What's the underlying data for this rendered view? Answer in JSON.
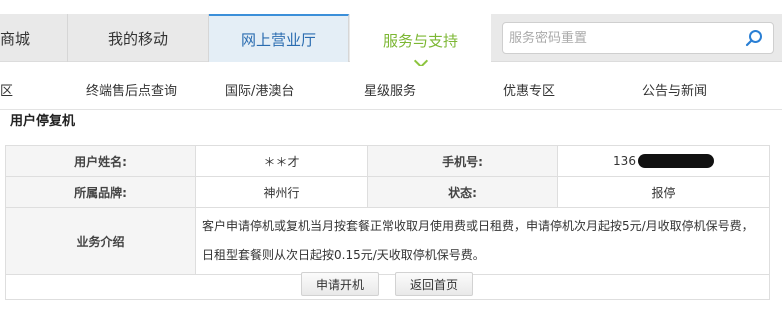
{
  "topnav": {
    "tabs": [
      {
        "label": "商城"
      },
      {
        "label": "我的移动"
      },
      {
        "label": "网上营业厅"
      },
      {
        "label": "服务与支持"
      }
    ],
    "search_placeholder": "服务密码重置",
    "search_icon": "search-icon"
  },
  "subnav": {
    "items": [
      {
        "label": "区"
      },
      {
        "label": "终端售后点查询"
      },
      {
        "label": "国际/港澳台"
      },
      {
        "label": "星级服务"
      },
      {
        "label": "优惠专区"
      },
      {
        "label": "公告与新闻"
      }
    ]
  },
  "section_title": "用户停复机",
  "info": {
    "name_label": "用户姓名:",
    "name_value": "＊＊才",
    "phone_label": "手机号:",
    "phone_value": "136",
    "brand_label": "所属品牌:",
    "brand_value": "神州行",
    "status_label": "状态:",
    "status_value": "报停",
    "intro_label": "业务介绍",
    "intro_text": "客户申请停机或复机当月按套餐正常收取月使用费或日租费，申请停机次月起按5元/月收取停机保号费，日租型套餐则从次日起按0.15元/天收取停机保号费。"
  },
  "buttons": {
    "open_label": "申请开机",
    "home_label": "返回首页"
  },
  "colors": {
    "accent_green": "#7cb733",
    "accent_blue": "#2a6cb0"
  }
}
